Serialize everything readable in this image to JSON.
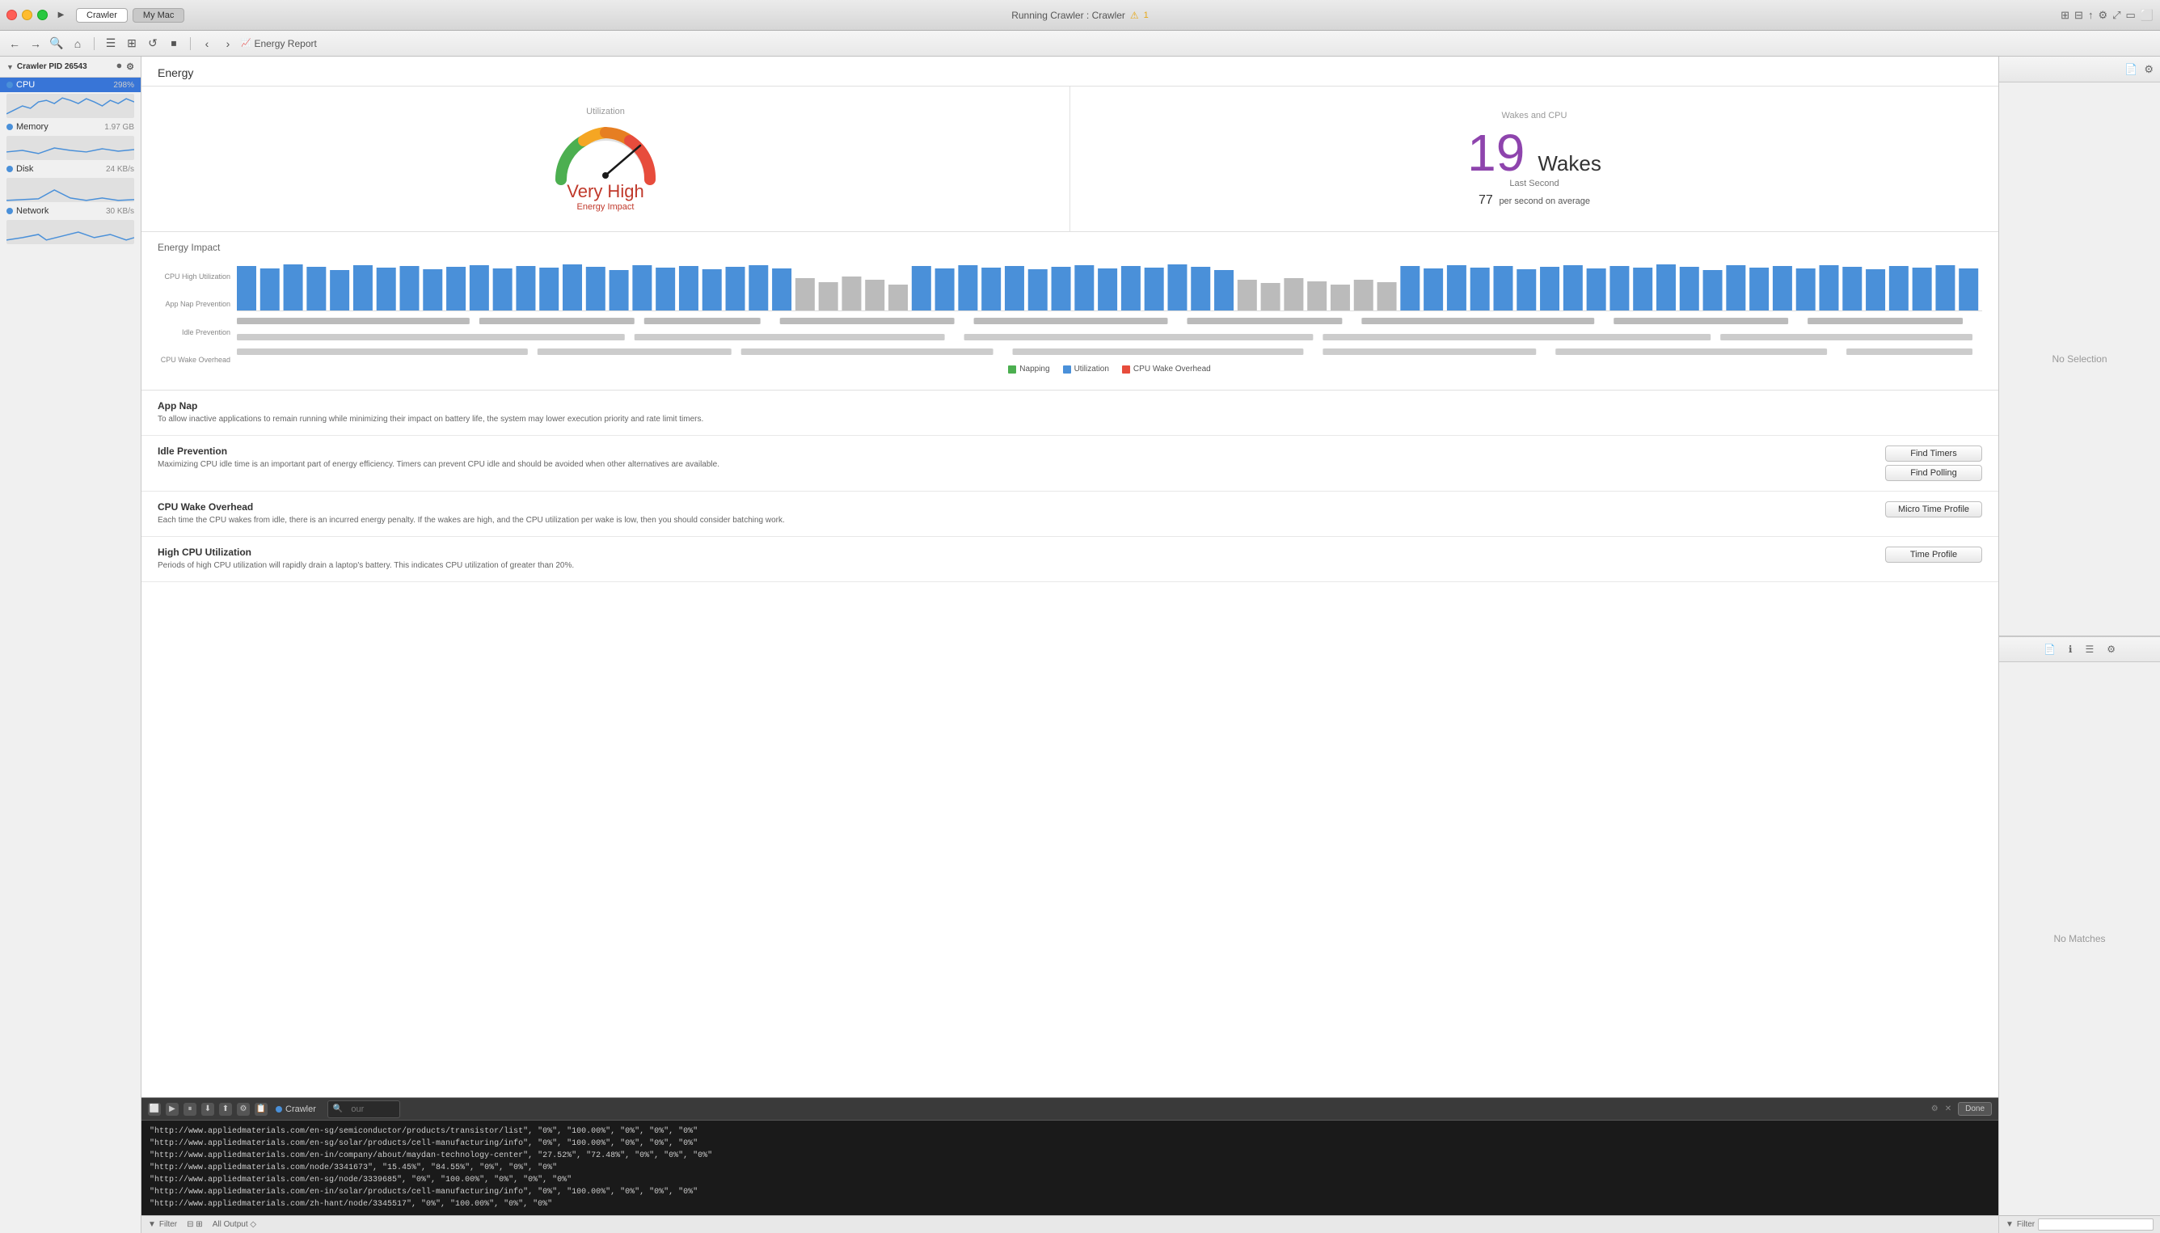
{
  "titlebar": {
    "title": "Running Crawler : Crawler",
    "warning_icon": "⚠",
    "warning_count": "1",
    "tab1": "Crawler",
    "tab2": "My Mac"
  },
  "toolbar": {
    "breadcrumb_icon": "📊",
    "breadcrumb_text": "Energy Report"
  },
  "sidebar": {
    "header_label": "Crawler PID 26543",
    "items": [
      {
        "label": "CPU",
        "value": "298%",
        "color": "#4a90d9"
      },
      {
        "label": "Memory",
        "value": "1.97 GB",
        "color": "#4a90d9"
      },
      {
        "label": "Disk",
        "value": "24 KB/s",
        "color": "#4a90d9"
      },
      {
        "label": "Network",
        "value": "30 KB/s",
        "color": "#4a90d9"
      }
    ]
  },
  "energy": {
    "section_title": "Energy",
    "utilization_label": "Utilization",
    "wakes_label": "Wakes and CPU",
    "gauge_title": "Very High",
    "gauge_subtitle": "Energy Impact",
    "wakes_number": "19",
    "wakes_word": "Wakes",
    "wakes_last_second": "Last Second",
    "wakes_avg_number": "77",
    "wakes_avg_text": "per second on average"
  },
  "energy_impact": {
    "section_title": "Energy Impact",
    "legend": [
      {
        "label": "Napping",
        "color": "#4caf50"
      },
      {
        "label": "Utilization",
        "color": "#4a90d9"
      },
      {
        "label": "CPU Wake Overhead",
        "color": "#e74c3c"
      }
    ],
    "chart_labels": [
      "CPU High Utilization",
      "App Nap Prevention",
      "Idle Prevention",
      "CPU Wake Overhead"
    ]
  },
  "app_nap": {
    "title": "App Nap",
    "description": "To allow inactive applications to remain running while minimizing their impact on battery life, the system may lower execution priority and rate limit timers."
  },
  "idle_prevention": {
    "title": "Idle Prevention",
    "description": "Maximizing CPU idle time is an important part of energy efficiency. Timers can prevent CPU idle and should be avoided when other alternatives are available.",
    "btn1": "Find Timers",
    "btn2": "Find Polling"
  },
  "cpu_wake_overhead": {
    "title": "CPU Wake Overhead",
    "description": "Each time the CPU wakes from idle, there is an incurred energy penalty. If the wakes are high, and the CPU utilization per wake is low, then you should consider batching work.",
    "btn": "Micro Time Profile"
  },
  "high_cpu": {
    "title": "High CPU Utilization",
    "description": "Periods of high CPU utilization will rapidly drain a laptop's battery. This indicates CPU utilization of greater than 20%.",
    "btn": "Time Profile"
  },
  "terminal": {
    "search_placeholder": "our",
    "process_label": "Crawler",
    "done_label": "Done",
    "lines": [
      "\"http://www.appliedmaterials.com/en-sg/semiconductor/products/transistor/list\", \"0%\", \"100.00%\", \"0%\", \"0%\", \"0%\"",
      "\"http://www.appliedmaterials.com/en-sg/solar/products/cell-manufacturing/info\", \"0%\", \"100.00%\", \"0%\", \"0%\", \"0%\"",
      "\"http://www.appliedmaterials.com/en-in/company/about/maydan-technology-center\", \"27.52%\", \"72.48%\", \"0%\", \"0%\", \"0%\"",
      "\"http://www.appliedmaterials.com/node/3341673\", \"15.45%\", \"84.55%\", \"0%\", \"0%\", \"0%\"",
      "\"http://www.appliedmaterials.com/en-sg/node/3339685\", \"0%\", \"100.00%\", \"0%\", \"0%\", \"0%\"",
      "\"http://www.appliedmaterials.com/en-in/solar/products/cell-manufacturing/info\", \"0%\", \"100.00%\", \"0%\", \"0%\", \"0%\"",
      "\"http://www.appliedmaterials.com/zh-hant/node/3345517\", \"0%\", \"100.00%\", \"0%\", \"0%\""
    ]
  },
  "right_panel": {
    "no_selection": "No Selection",
    "no_matches": "No Matches"
  },
  "status_bar": {
    "filter_label": "Filter",
    "output_label": "All Output ◇"
  }
}
